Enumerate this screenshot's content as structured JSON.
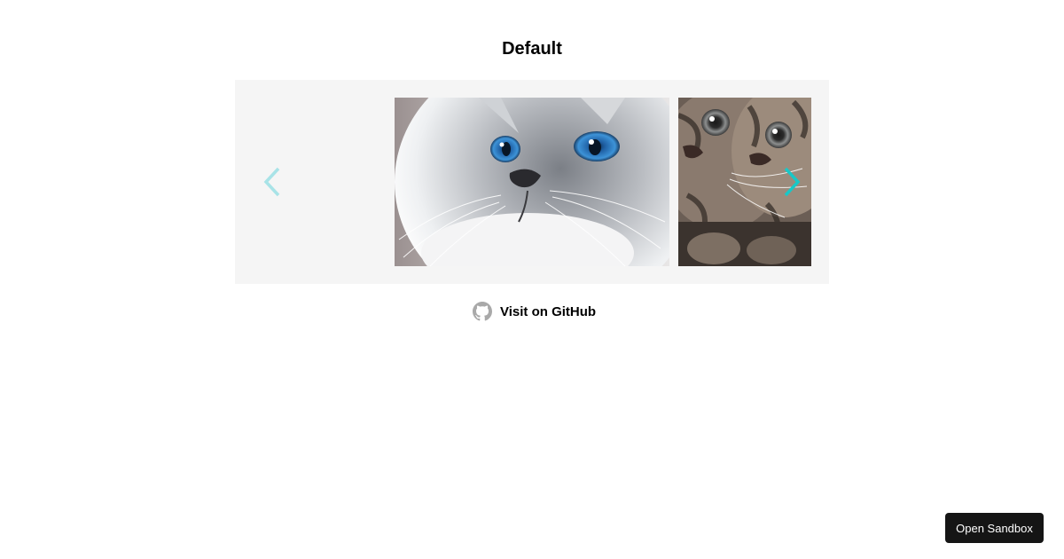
{
  "header": {
    "title": "Default"
  },
  "carousel": {
    "prev_icon": "chevron-left-icon",
    "next_icon": "chevron-right-icon",
    "arrow_color": "#17c8c8",
    "background": "#f5f5f5",
    "slides": [
      {
        "subject": "white cat with blue eyes"
      },
      {
        "subject": "two tabby kittens"
      }
    ]
  },
  "footer": {
    "github_label": "Visit on GitHub",
    "github_icon": "github-icon"
  },
  "sandbox": {
    "label": "Open Sandbox"
  }
}
